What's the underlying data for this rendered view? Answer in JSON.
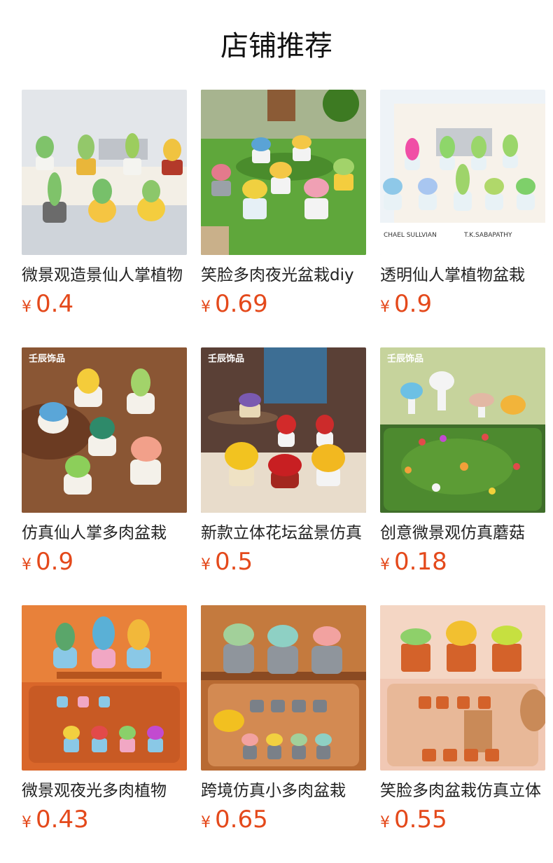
{
  "title": "店铺推荐",
  "currency_symbol": "¥",
  "products": [
    {
      "name": "微景观造景仙人掌植物",
      "price": "0.4",
      "image": "cactus-pots-on-books"
    },
    {
      "name": "笑脸多肉夜光盆栽diy",
      "price": "0.69",
      "image": "smiley-succulents-on-grass"
    },
    {
      "name": "透明仙人掌植物盆栽",
      "price": "0.9",
      "image": "clear-cactus-on-books"
    },
    {
      "name": "仿真仙人掌多肉盆栽",
      "price": "0.9",
      "image": "cactus-on-wood-table",
      "watermark": "壬辰饰品"
    },
    {
      "name": "新款立体花坛盆景仿真",
      "price": "0.5",
      "image": "flower-pots-on-table",
      "watermark": "壬辰饰品"
    },
    {
      "name": "创意微景观仿真蘑菇",
      "price": "0.18",
      "image": "mushrooms-on-moss",
      "watermark": "壬辰饰品"
    },
    {
      "name": "微景观夜光多肉植物",
      "price": "0.43",
      "image": "glow-succulents-shelf"
    },
    {
      "name": "跨境仿真小多肉盆栽",
      "price": "0.65",
      "image": "grey-pot-succulents"
    },
    {
      "name": "笑脸多肉盆栽仿真立体",
      "price": "0.55",
      "image": "smiley-terracotta-pots"
    }
  ],
  "colors": {
    "price": "#e4491b",
    "title": "#111111"
  }
}
